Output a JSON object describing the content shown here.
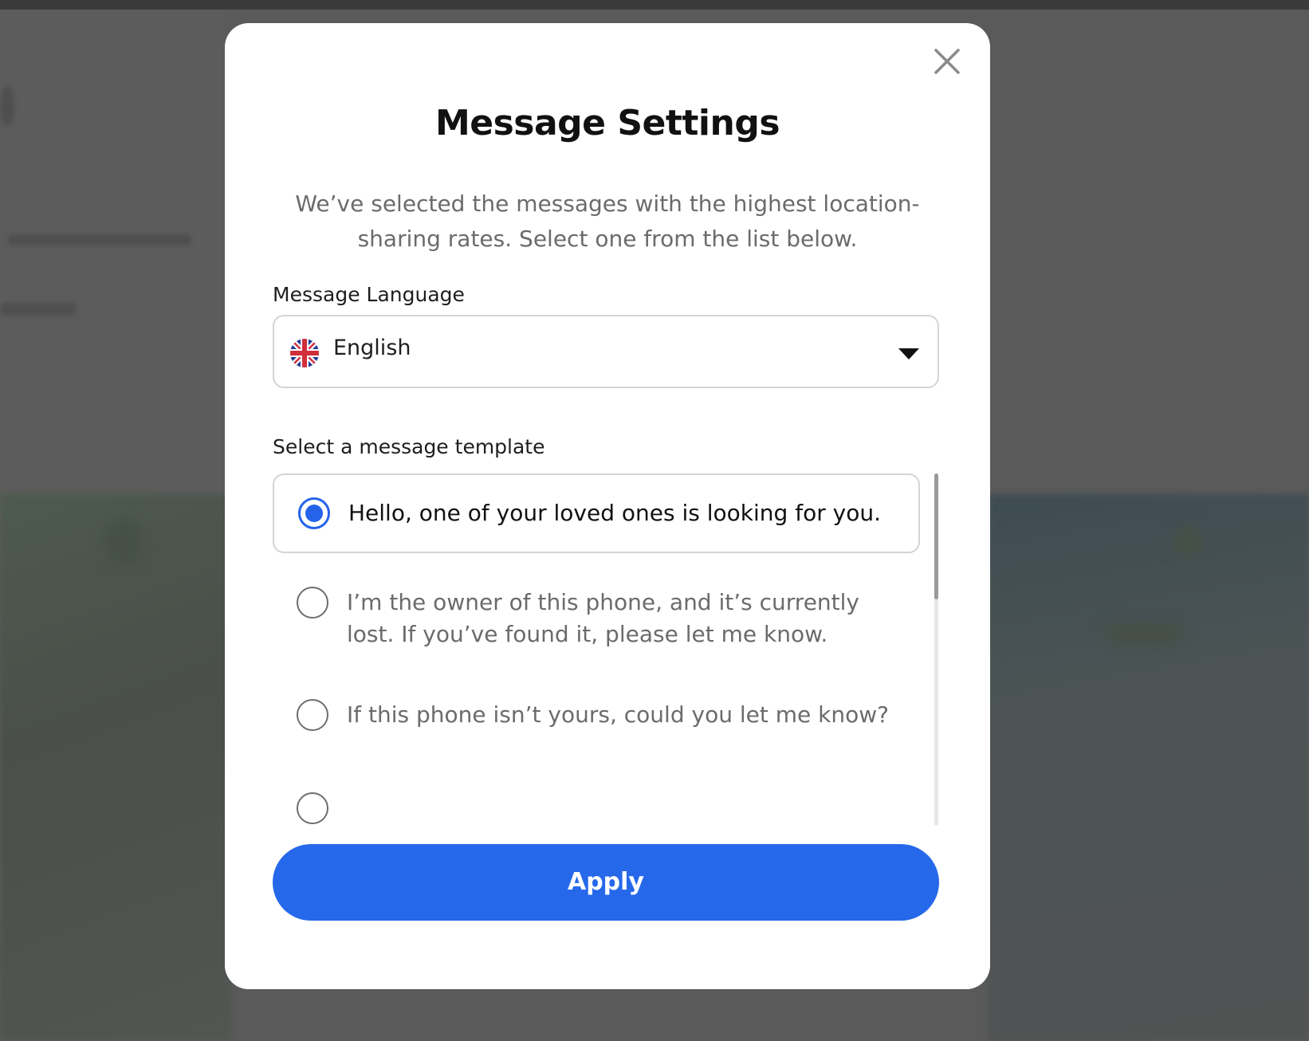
{
  "modal": {
    "title": "Message Settings",
    "description": "We’ve selected the messages with the highest location-sharing rates. Select one from the list below.",
    "close_icon": "close-icon"
  },
  "language": {
    "label": "Message Language",
    "value": "English",
    "flag_icon": "uk-flag-icon",
    "dropdown_icon": "caret-down-icon"
  },
  "templates": {
    "label": "Select a message template",
    "selected_index": 0,
    "items": [
      {
        "text": "Hello, one of your loved ones is looking for you.",
        "selected": true
      },
      {
        "text": "I’m the owner of this phone, and it’s currently lost. If you’ve found it, please let me know.",
        "selected": false
      },
      {
        "text": "If this phone isn’t yours, could you let me know?",
        "selected": false
      }
    ]
  },
  "actions": {
    "apply_label": "Apply"
  },
  "colors": {
    "accent": "#2668ea",
    "overlay": "#5a5a5a",
    "title_text": "#111111",
    "muted_text": "#6b6b6b",
    "border": "#d4d4d4"
  }
}
